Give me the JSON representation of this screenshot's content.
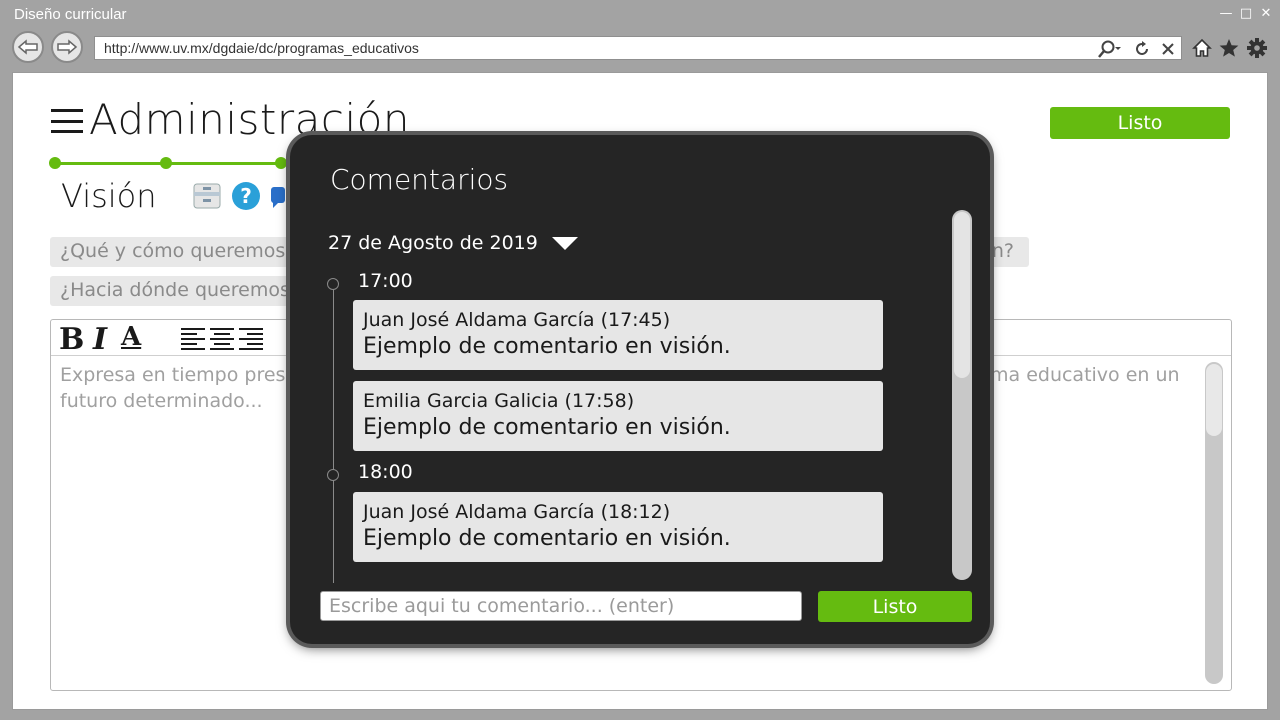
{
  "window": {
    "title": "Diseño curricular"
  },
  "browser": {
    "url": "http://www.uv.mx/dgdaie/dc/programas_educativos"
  },
  "header": {
    "title": "Administración",
    "done_label": "Listo"
  },
  "section": {
    "title": "Visión"
  },
  "questions": [
    {
      "start": "¿Qué y cómo queremos",
      "end": "an?"
    },
    {
      "start": "¿Hacia dónde queremos"
    }
  ],
  "editor": {
    "bold": "B",
    "italic": "I",
    "underline": "A",
    "placeholder_start": "Expresa en tiempo pres",
    "placeholder_tail": "ma educativo en un",
    "placeholder_line2": "futuro determinado..."
  },
  "modal": {
    "title": "Comentarios",
    "date": "27 de Agosto de 2019",
    "groups": [
      {
        "time": "17:00",
        "comments": [
          {
            "author": "Juan José Aldama García (17:45)",
            "text": "Ejemplo de comentario en visión."
          },
          {
            "author": "Emilia Garcia Galicia (17:58)",
            "text": "Ejemplo de comentario en visión."
          }
        ]
      },
      {
        "time": "18:00",
        "comments": [
          {
            "author": "Juan José Aldama García (18:12)",
            "text": "Ejemplo de comentario en visión."
          }
        ]
      }
    ],
    "input_placeholder": "Escribe aqui tu comentario... (enter)",
    "submit_label": "Listo"
  },
  "colors": {
    "accent": "#65bb10",
    "modal_bg": "#252525",
    "chrome": "#a3a3a3"
  }
}
